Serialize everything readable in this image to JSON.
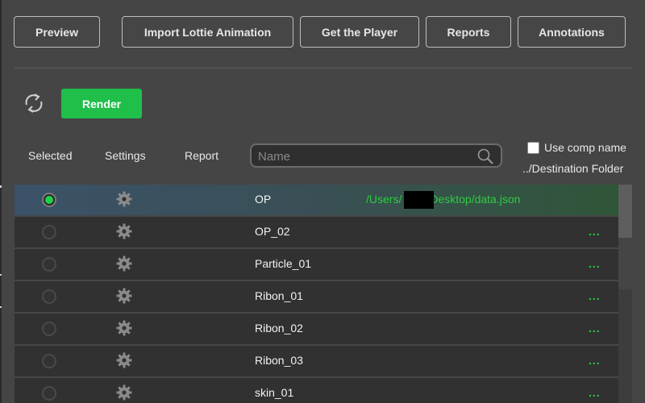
{
  "toolbar": {
    "preview": "Preview",
    "import_lottie": "Import Lottie Animation",
    "get_player": "Get the Player",
    "reports": "Reports",
    "annotations": "Annotations"
  },
  "actions": {
    "render": "Render"
  },
  "columns": {
    "selected": "Selected",
    "settings": "Settings",
    "report": "Report"
  },
  "search": {
    "placeholder": "Name"
  },
  "options": {
    "use_comp_name": "Use comp name",
    "destination_folder": "../Destination Folder"
  },
  "comps": [
    {
      "name": "OP",
      "path": "/Users/",
      "path_tail": "Desktop/data.json",
      "selected": true
    },
    {
      "name": "OP_02",
      "more": "..."
    },
    {
      "name": "Particle_01",
      "more": "..."
    },
    {
      "name": "Ribon_01",
      "more": "..."
    },
    {
      "name": "Ribon_02",
      "more": "..."
    },
    {
      "name": "Ribon_03",
      "more": "..."
    },
    {
      "name": "skin_01",
      "more": "..."
    }
  ],
  "colors": {
    "accent_green": "#1fbf4a",
    "path_green": "#2ecc40",
    "background": "#454545",
    "row_bg": "#313131"
  }
}
